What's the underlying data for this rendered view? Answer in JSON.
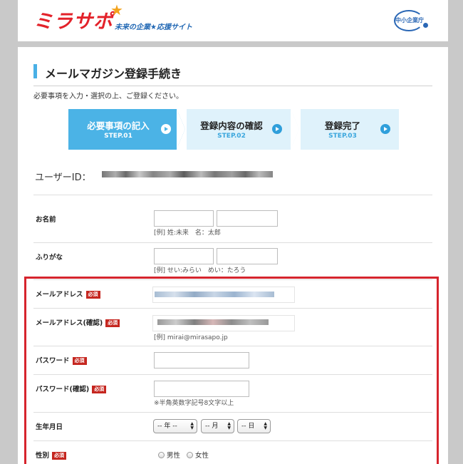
{
  "header": {
    "logo_text": "ミラサポ",
    "tagline": "未来の企業★応援サイト",
    "agency": "中小企業庁"
  },
  "page": {
    "title": "メールマガジン登録手続き",
    "intro": "必要事項を入力・選択の上、ご登録ください。"
  },
  "steps": [
    {
      "label": "必要事項の記入",
      "sub": "STEP.01"
    },
    {
      "label": "登録内容の確認",
      "sub": "STEP.02"
    },
    {
      "label": "登録完了",
      "sub": "STEP.03"
    }
  ],
  "user_id": {
    "label": "ユーザーID："
  },
  "form": {
    "required_badge": "必須",
    "name": {
      "label": "お名前",
      "hint": "[例] 姓:未来　名：太郎"
    },
    "furigana": {
      "label": "ふりがな",
      "hint": "[例] せい:みらい　めい：たろう"
    },
    "email": {
      "label": "メールアドレス"
    },
    "email_confirm": {
      "label": "メールアドレス(確認)",
      "hint": "[例] mirai@mirasapo.jp"
    },
    "password": {
      "label": "パスワード"
    },
    "password_confirm": {
      "label": "パスワード(確認)",
      "hint": "※半角英数字記号8文字以上"
    },
    "birthdate": {
      "label": "生年月日",
      "year": "-- 年 --",
      "month": "-- 月",
      "day": "-- 日"
    },
    "gender": {
      "label": "性別",
      "options": [
        "男性",
        "女性"
      ]
    }
  },
  "colors": {
    "brand_red": "#e3222a",
    "accent_blue": "#4bb3e6",
    "step_inactive": "#dff2fb",
    "highlight_red": "#d6242d"
  }
}
